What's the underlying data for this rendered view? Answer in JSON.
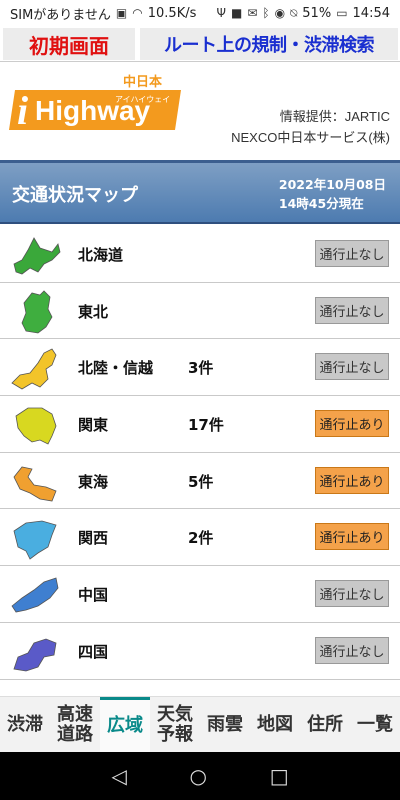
{
  "status_bar": {
    "carrier": "SIMがありません",
    "speed": "10.5K/s",
    "battery": "51%",
    "time": "14:54"
  },
  "top_buttons": {
    "initial": "初期画面",
    "route": "ルート上の規制・渋滞検索"
  },
  "logo": {
    "top_text": "中日本",
    "main_text": "Highway",
    "sub_text": "アイハイウェイ",
    "i_letter": "i"
  },
  "provider": {
    "line1": "情報提供：JARTIC",
    "line2": "NEXCO中日本サービス(株)"
  },
  "map_header": {
    "title": "交通状況マップ",
    "date": "2022年10月08日",
    "time": "14時45分現在"
  },
  "regions": [
    {
      "name": "北海道",
      "count": "",
      "status": "通行止なし",
      "closed": false,
      "icon": "hokkaido-map-icon",
      "color": "#3aa83a"
    },
    {
      "name": "東北",
      "count": "",
      "status": "通行止なし",
      "closed": false,
      "icon": "tohoku-map-icon",
      "color": "#3fae3f"
    },
    {
      "name": "北陸・信越",
      "count": "3件",
      "status": "通行止なし",
      "closed": false,
      "icon": "hokuriku-map-icon",
      "color": "#f2c42a"
    },
    {
      "name": "関東",
      "count": "17件",
      "status": "通行止あり",
      "closed": true,
      "icon": "kanto-map-icon",
      "color": "#d8d820"
    },
    {
      "name": "東海",
      "count": "5件",
      "status": "通行止あり",
      "closed": true,
      "icon": "tokai-map-icon",
      "color": "#f0a030"
    },
    {
      "name": "関西",
      "count": "2件",
      "status": "通行止あり",
      "closed": true,
      "icon": "kansai-map-icon",
      "color": "#4aaee0"
    },
    {
      "name": "中国",
      "count": "",
      "status": "通行止なし",
      "closed": false,
      "icon": "chugoku-map-icon",
      "color": "#3f7fd0"
    },
    {
      "name": "四国",
      "count": "",
      "status": "通行止なし",
      "closed": false,
      "icon": "shikoku-map-icon",
      "color": "#5a5ac8"
    },
    {
      "name": "",
      "count": "",
      "status": "",
      "closed": false,
      "icon": "kyushu-map-icon",
      "color": "#2c4fb0"
    }
  ],
  "tabs": [
    {
      "label1": "渋滞",
      "label2": "",
      "active": false
    },
    {
      "label1": "高速",
      "label2": "道路",
      "active": false
    },
    {
      "label1": "広域",
      "label2": "",
      "active": true
    },
    {
      "label1": "天気",
      "label2": "予報",
      "active": false
    },
    {
      "label1": "雨雲",
      "label2": "",
      "active": false
    },
    {
      "label1": "地図",
      "label2": "",
      "active": false
    },
    {
      "label1": "住所",
      "label2": "",
      "active": false
    },
    {
      "label1": "一覧",
      "label2": "",
      "active": false
    }
  ],
  "nav": {
    "back": "◁",
    "home": "○",
    "recent": "□"
  }
}
